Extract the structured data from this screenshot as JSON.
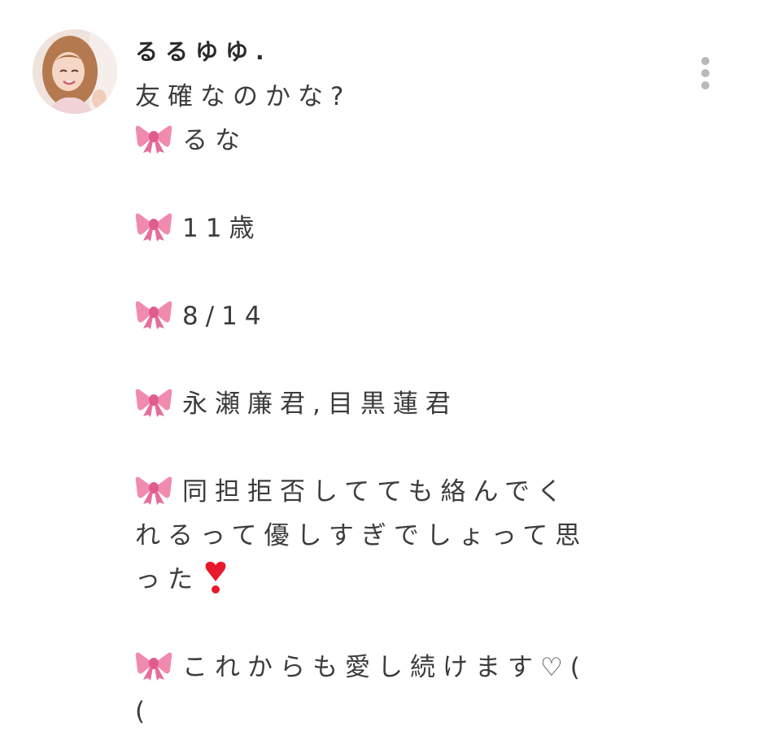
{
  "post": {
    "username": "るるゆゆ.",
    "intro": "友確なのかな?",
    "items": [
      {
        "icon": "ribbon-icon",
        "text": "るな"
      },
      {
        "icon": "ribbon-icon",
        "text": "11歳"
      },
      {
        "icon": "ribbon-icon",
        "text": "8/14"
      },
      {
        "icon": "ribbon-icon",
        "text": "永瀬廉君,目黒蓮君"
      },
      {
        "icon": "ribbon-icon",
        "text": "同担拒否してても絡んでく",
        "cont1": "れるって優しすぎでしょって思",
        "cont2": "った"
      },
      {
        "icon": "ribbon-icon",
        "text": "これからも愛し続けます♡(",
        "cont1": "("
      }
    ],
    "colors": {
      "ribbon": "#f08bb0",
      "heart": "#e8192c",
      "text": "#3c3c3c",
      "more_dots": "#b8b8b8"
    },
    "more_icon": "more-vertical-icon",
    "heart_icon": "heavy-heart-exclamation-icon"
  }
}
